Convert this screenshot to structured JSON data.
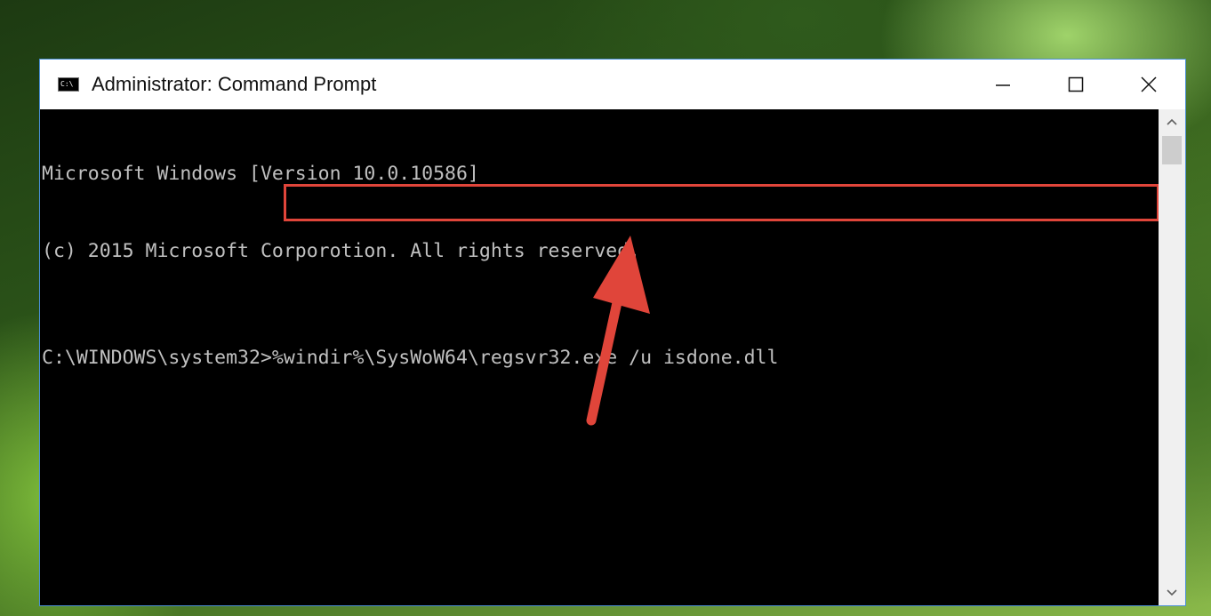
{
  "window": {
    "title": "Administrator: Command Prompt",
    "icon_text": "C:\\",
    "controls": [
      "minimize-icon",
      "maximize-icon",
      "close-icon"
    ]
  },
  "console": {
    "lines": [
      "Microsoft Windows [Version 10.0.10586]",
      "(c) 2015 Microsoft Corporotion. All rights reserved."
    ],
    "prompt": "C:\\WINDOWS\\system32>",
    "command": "%windir%\\SysWoW64\\regsvr32.exe /u isdone.dll"
  },
  "annotation": {
    "highlight_color": "#e0453a",
    "arrow_color": "#e0453a"
  }
}
